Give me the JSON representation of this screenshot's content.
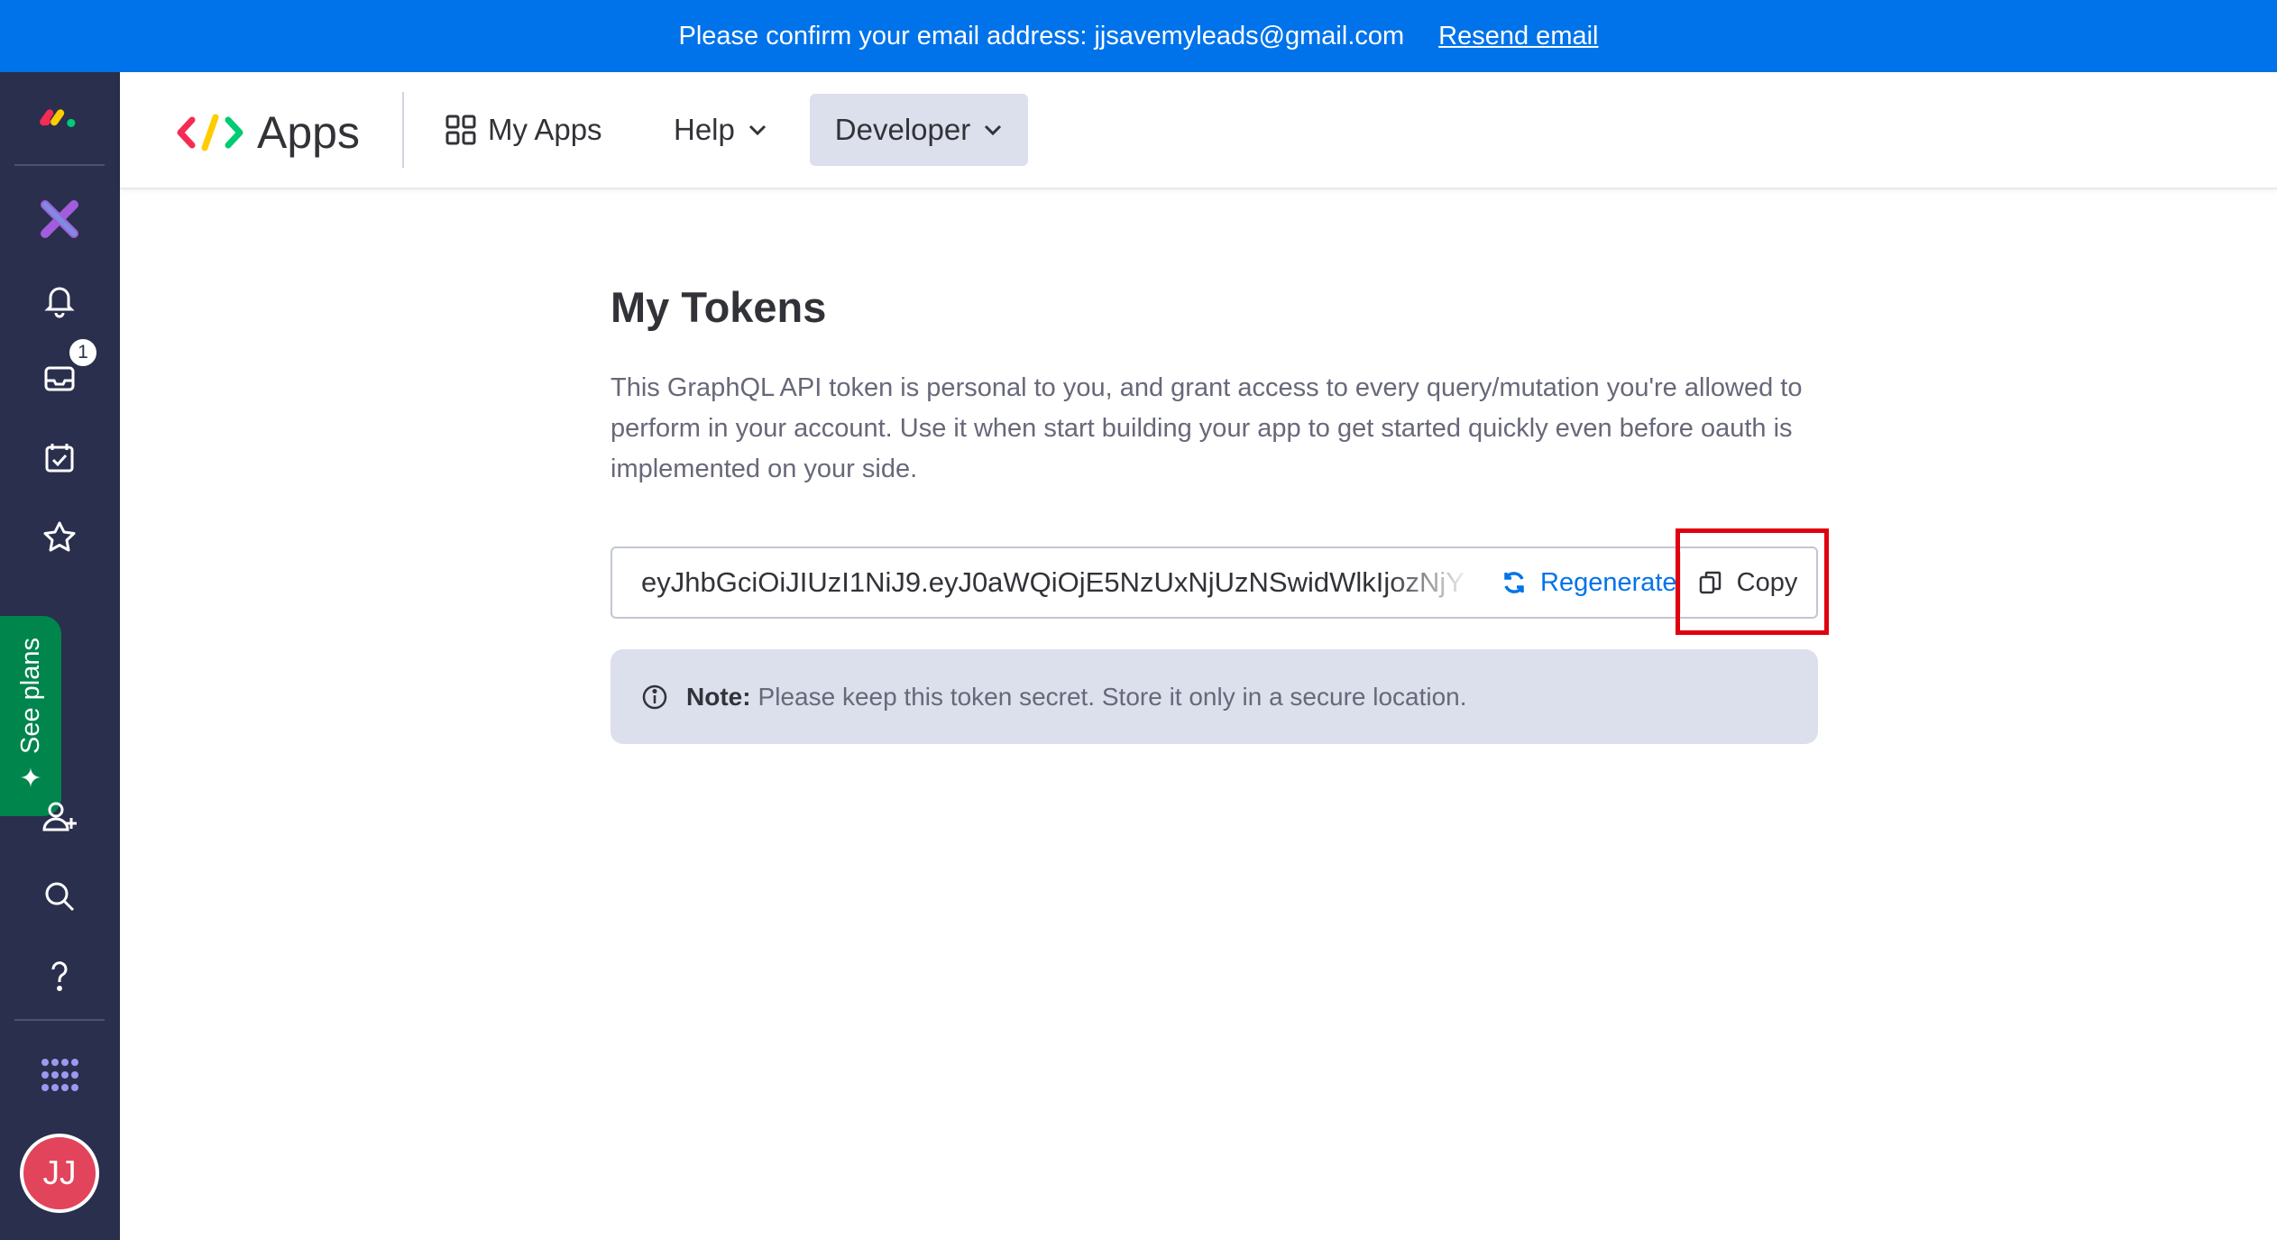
{
  "banner": {
    "message": "Please confirm your email address: jjsavemyleads@gmail.com",
    "resend_label": "Resend email",
    "color": "#0073ea"
  },
  "rail": {
    "icons": [
      "monday-logo-icon",
      "apps-x-icon",
      "bell-icon",
      "inbox-icon",
      "my-work-calendar-icon",
      "favorites-star-icon",
      "invite-user-icon",
      "search-icon",
      "help-icon",
      "apps-grid-icon"
    ],
    "inbox_badge": "1",
    "see_plans_label": "See plans",
    "avatar_initials": "JJ",
    "avatar_color": "#e2445c"
  },
  "header": {
    "app_title": "Apps",
    "nav": {
      "my_apps": "My Apps",
      "help": "Help",
      "developer": "Developer"
    }
  },
  "main": {
    "title": "My Tokens",
    "description": "This GraphQL API token is personal to you, and grant access to every query/mutation you're allowed to perform in your account. Use it when start building your app to get started quickly even before oauth is implemented on your side.",
    "token_value": "eyJhbGciOiJIUzI1NiJ9.eyJ0aWQiOjE5NzUxNjUzNSwidWlkIjozNjY",
    "regenerate_label": "Regenerate",
    "copy_label": "Copy",
    "note_label": "Note:",
    "note_text": "Please keep this token secret. Store it only in a secure location.",
    "highlight_color": "#e0000f"
  }
}
